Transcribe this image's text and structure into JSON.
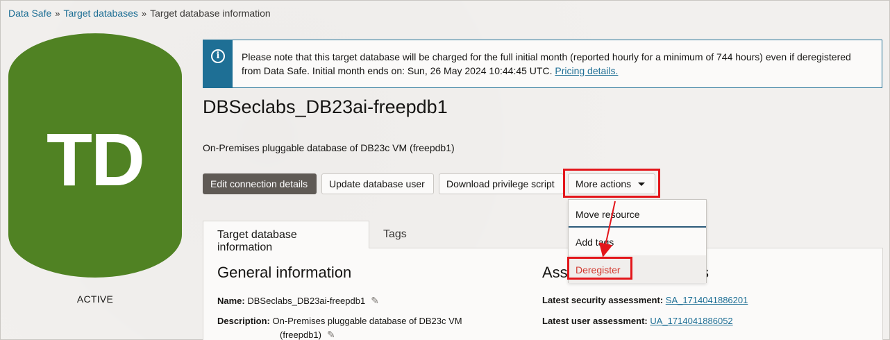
{
  "breadcrumb": [
    "Data Safe",
    "Target databases",
    "Target database information"
  ],
  "breadcrumb_sep": "»",
  "badge": {
    "letters": "TD",
    "color": "#508223",
    "status": "ACTIVE"
  },
  "notice": {
    "icon": "info-icon",
    "line1": "Please note that this target database will be charged for the full initial month (reported hourly for a minimum of 744 hours) even if deregistered",
    "line2": "from Data Safe. Initial month ends on: Sun, 26 May 2024 10:44:45 UTC.",
    "link": "Pricing details."
  },
  "title": "DBSeclabs_DB23ai-freepdb1",
  "subtitle": "On-Premises pluggable database of DB23c VM (freepdb1)",
  "buttons": {
    "edit": "Edit connection details",
    "update": "Update database user",
    "download": "Download privilege script",
    "more": "More actions"
  },
  "menu": {
    "items": [
      "Move resource",
      "Add tags",
      "Deregister"
    ]
  },
  "tabs": [
    "Target database information",
    "Tags"
  ],
  "general": {
    "heading": "General information",
    "name_label": "Name:",
    "name_value": "DBSeclabs_DB23ai-freepdb1",
    "desc_label": "Description:",
    "desc_value": "On-Premises pluggable database of DB23c VM",
    "desc_value2": "(freepdb1)"
  },
  "assessment": {
    "heading_left": "Ass",
    "heading_right": "s",
    "security_label": "Latest security assessment:",
    "security_value": "SA_1714041886201",
    "user_label": "Latest user assessment:",
    "user_value": "UA_1714041886052"
  },
  "colors": {
    "accent": "#1e6f95",
    "highlight": "#e3161b",
    "danger": "#d2382e"
  }
}
